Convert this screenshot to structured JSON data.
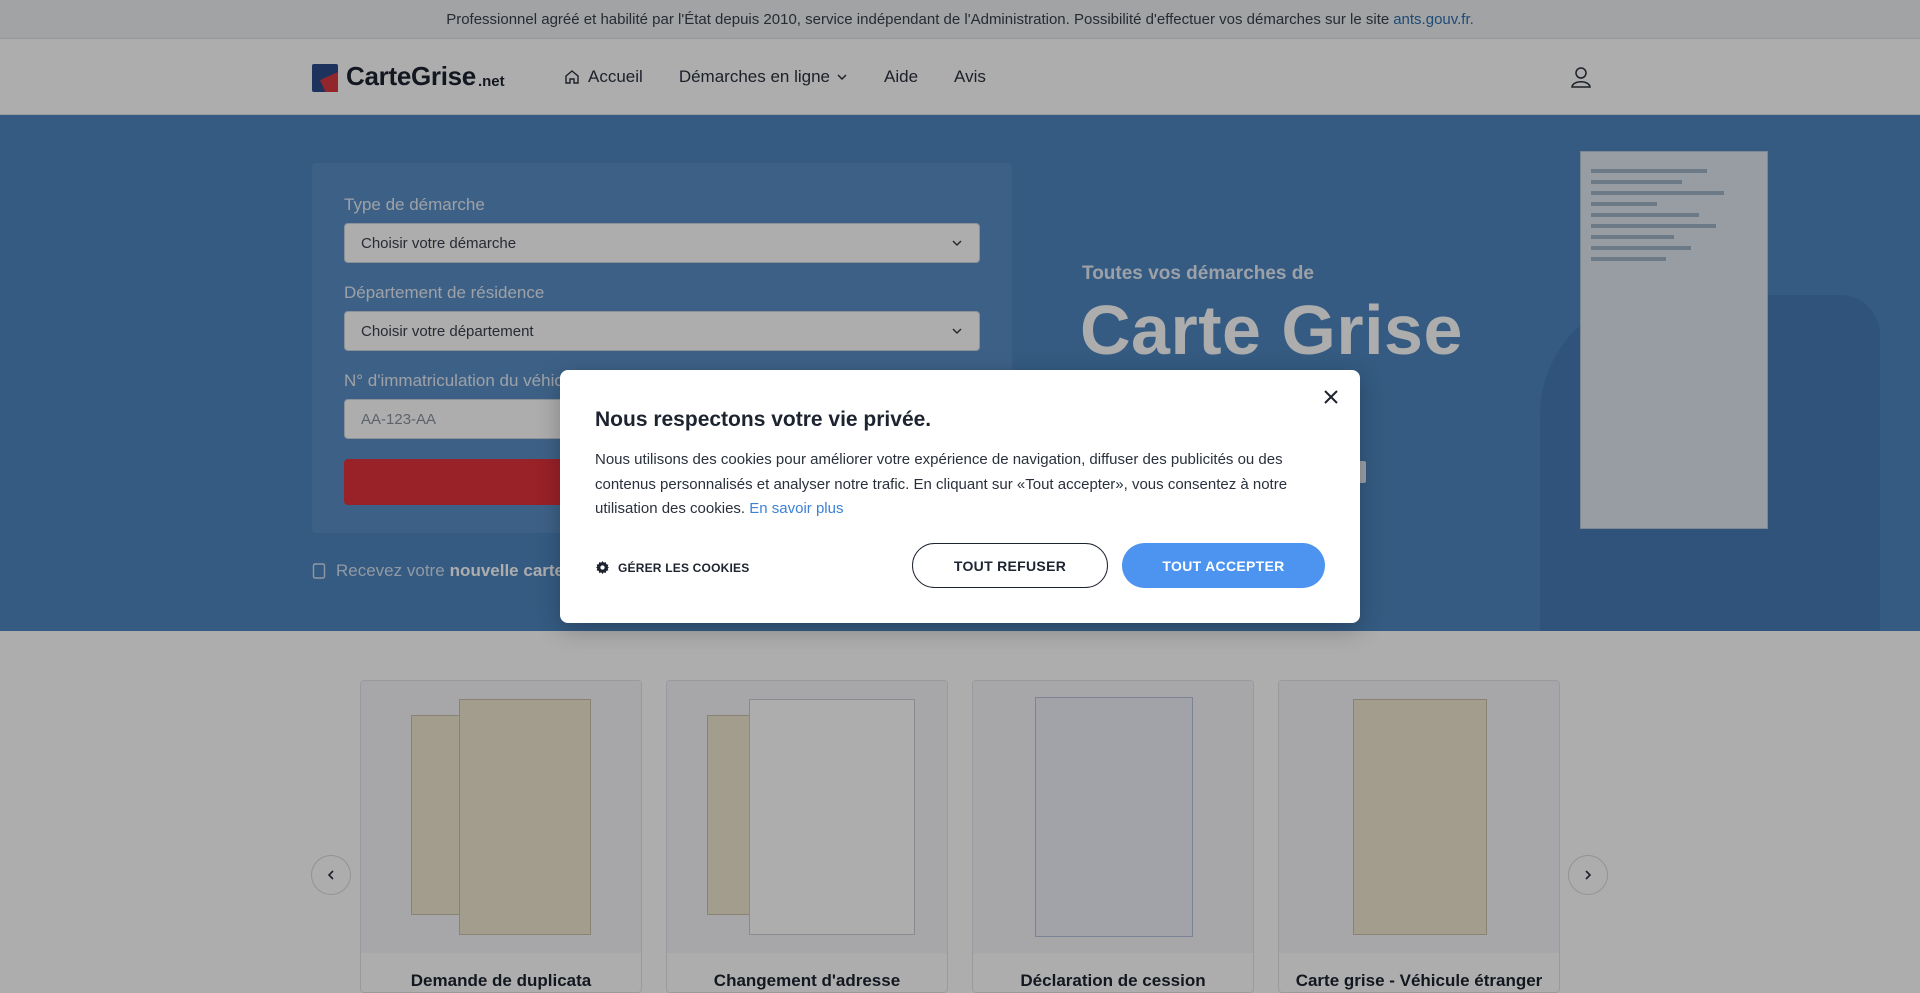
{
  "notice": {
    "text": "Professionnel agréé et habilité par l'État depuis 2010, service indépendant de l'Administration. Possibilité d'effectuer vos démarches sur le site",
    "link": "ants.gouv.fr."
  },
  "header": {
    "logo_text": "CarteGrise",
    "logo_suffix": ".net",
    "nav": [
      {
        "label": "Accueil",
        "icon": "home-icon"
      },
      {
        "label": "Démarches en ligne",
        "icon": "chevron-down-icon"
      },
      {
        "label": "Aide"
      },
      {
        "label": "Avis"
      }
    ],
    "user_icon": "user-icon"
  },
  "hero": {
    "form": {
      "type_label": "Type de démarche",
      "type_placeholder": "Choisir votre démarche",
      "dept_label": "Département de résidence",
      "dept_placeholder": "Choisir votre département",
      "immat_label": "N° d'immatriculation du véhic",
      "immat_placeholder": "AA-123-AA"
    },
    "note_prefix": "Recevez votre",
    "note_bold": "nouvelle carte",
    "subtitle": "Toutes vos démarches de",
    "title": "Carte Grise"
  },
  "cards": [
    {
      "title": "Demande de duplicata"
    },
    {
      "title": "Changement d'adresse"
    },
    {
      "title": "Déclaration de cession"
    },
    {
      "title": "Carte grise - Véhicule étranger"
    }
  ],
  "cookie_modal": {
    "title": "Nous respectons votre vie privée.",
    "body": "Nous utilisons des cookies pour améliorer votre expérience de navigation, diffuser des publicités ou des contenus personnalisés et analyser notre trafic. En cliquant sur «Tout accepter», vous consentez à notre utilisation des cookies.",
    "learn_more": "En savoir plus",
    "manage_label": "GÉRER LES COOKIES",
    "refuse_label": "TOUT REFUSER",
    "accept_label": "TOUT ACCEPTER"
  },
  "colors": {
    "brand_blue": "#4f86c0",
    "brand_red": "#e2323c",
    "accept_blue": "#4c94f0"
  }
}
